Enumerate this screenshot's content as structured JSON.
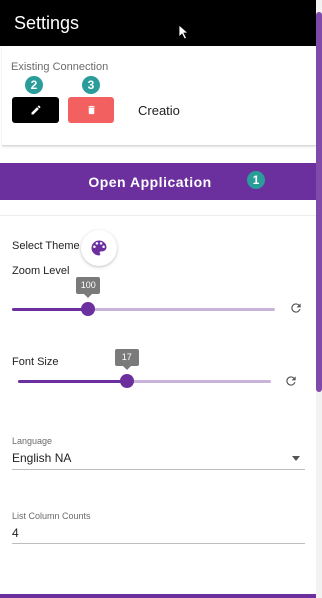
{
  "header": {
    "title": "Settings"
  },
  "connection": {
    "label": "Existing Connection",
    "name": "Creatio",
    "edit_badge": "2",
    "delete_badge": "3"
  },
  "open_app": {
    "label": "Open Application",
    "badge": "1"
  },
  "theme": {
    "label": "Select Theme"
  },
  "zoom": {
    "label": "Zoom Level",
    "value": "100",
    "fraction": 0.29
  },
  "font_size": {
    "label": "Font Size",
    "value": "17",
    "fraction": 0.43
  },
  "language": {
    "label": "Language",
    "value": "English NA"
  },
  "list_columns": {
    "label": "List Column Counts",
    "value": "4"
  },
  "colors": {
    "accent": "#6b2f9e",
    "badge": "#2a9d9a",
    "danger": "#f26060",
    "header": "#000000"
  },
  "icons": [
    "cursor-icon",
    "pencil-icon",
    "trash-icon",
    "palette-icon",
    "refresh-icon",
    "chevron-down-icon"
  ]
}
